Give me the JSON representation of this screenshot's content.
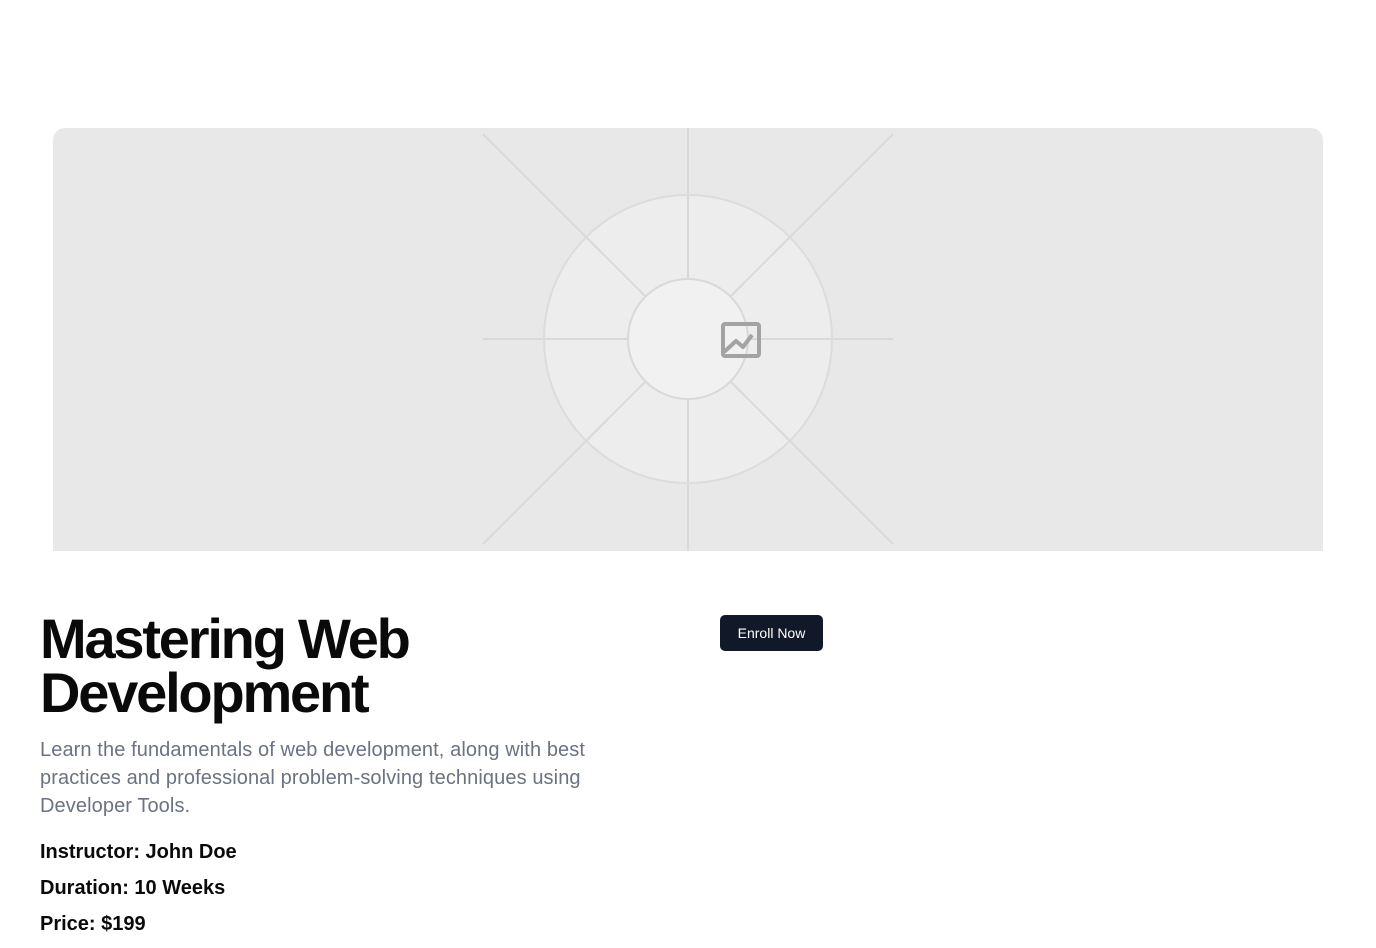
{
  "hero": {
    "image_icon": "image-placeholder-icon"
  },
  "course": {
    "title_line1": "Mastering Web",
    "title_line2": "Development",
    "description": "Learn the fundamentals of web development, along with best practices and professional problem-solving techniques using Developer Tools.",
    "instructor": "Instructor: John Doe",
    "duration": "Duration: 10 Weeks",
    "price": "Price: $199"
  },
  "actions": {
    "enroll_label": "Enroll Now"
  },
  "colors": {
    "placeholder_bg": "#e8e8e8",
    "button_bg": "#111827",
    "description_text": "#6b7280"
  }
}
